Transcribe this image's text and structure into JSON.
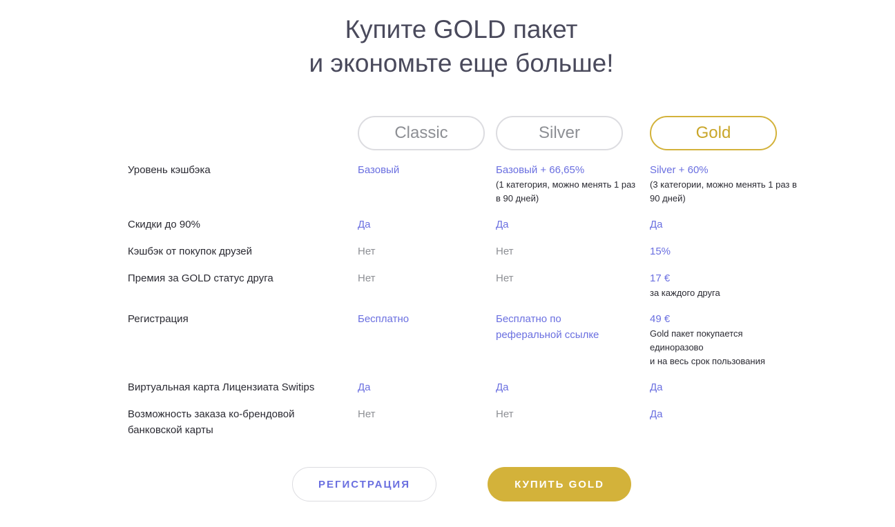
{
  "headline": {
    "line1": "Купите GOLD пакет",
    "line2": "и экономьте еще больше!"
  },
  "plans": {
    "classic": "Classic",
    "silver": "Silver",
    "gold": "Gold"
  },
  "rows": {
    "cashback_level": {
      "label": "Уровень кэшбэка",
      "classic": "Базовый",
      "silver": "Базовый + 66,65%",
      "silver_note": "(1 категория, можно менять 1 раз в 90 дней)",
      "gold": "Silver + 60%",
      "gold_note": "(3 категории, можно менять 1 раз в 90 дней)"
    },
    "discounts": {
      "label": "Скидки до 90%",
      "classic": "Да",
      "silver": "Да",
      "gold": "Да"
    },
    "friends_cashback": {
      "label": "Кэшбэк от покупок друзей",
      "classic": "Нет",
      "silver": "Нет",
      "gold": "15%"
    },
    "friend_gold_bonus": {
      "label": "Премия за GOLD статус друга",
      "classic": "Нет",
      "silver": "Нет",
      "gold": "17 €",
      "gold_note": "за каждого друга"
    },
    "registration": {
      "label": "Регистрация",
      "classic": "Бесплатно",
      "silver": "Бесплатно по реферальной ссылке",
      "gold": "49 €",
      "gold_note_1": "Gold пакет покупается единоразово",
      "gold_note_2": "и на весь срок пользования"
    },
    "virtual_card": {
      "label": "Виртуальная карта Лицензиата Switips",
      "classic": "Да",
      "silver": "Да",
      "gold": "Да"
    },
    "cobrand_card": {
      "label": "Возможность заказа ко-брендовой банковской карты",
      "classic": "Нет",
      "silver": "Нет",
      "gold": "Да"
    }
  },
  "buttons": {
    "register": "РЕГИСТРАЦИЯ",
    "buy_gold": "КУПИТЬ GOLD"
  },
  "colors": {
    "accent_blue": "#6a6fe0",
    "gold": "#d3b23a",
    "muted": "#8d8f94"
  }
}
